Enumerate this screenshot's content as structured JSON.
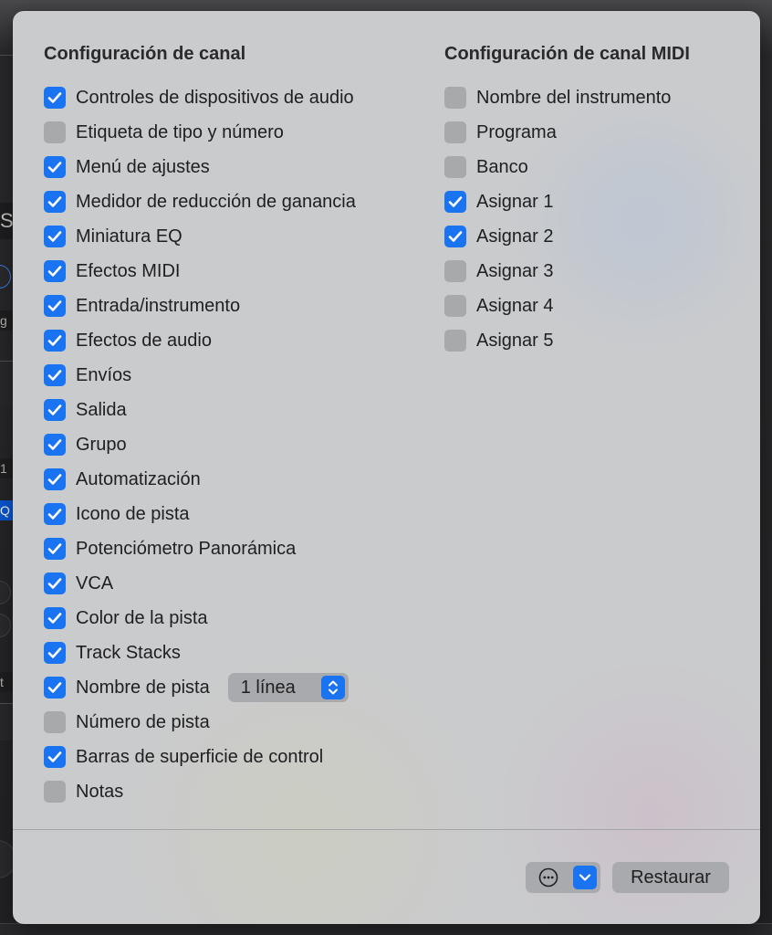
{
  "left_column": {
    "title": "Configuración de canal",
    "options": [
      {
        "label": "Controles de dispositivos de audio",
        "checked": true
      },
      {
        "label": "Etiqueta de tipo y número",
        "checked": false
      },
      {
        "label": "Menú de ajustes",
        "checked": true
      },
      {
        "label": "Medidor de reducción de ganancia",
        "checked": true
      },
      {
        "label": "Miniatura EQ",
        "checked": true
      },
      {
        "label": "Efectos MIDI",
        "checked": true
      },
      {
        "label": "Entrada/instrumento",
        "checked": true
      },
      {
        "label": "Efectos de audio",
        "checked": true
      },
      {
        "label": "Envíos",
        "checked": true
      },
      {
        "label": "Salida",
        "checked": true
      },
      {
        "label": "Grupo",
        "checked": true
      },
      {
        "label": "Automatización",
        "checked": true
      },
      {
        "label": "Icono de pista",
        "checked": true
      },
      {
        "label": "Potenciómetro Panorámica",
        "checked": true
      },
      {
        "label": "VCA",
        "checked": true
      },
      {
        "label": "Color de la pista",
        "checked": true
      },
      {
        "label": "Track Stacks",
        "checked": true
      },
      {
        "label": "Nombre de pista",
        "checked": true
      },
      {
        "label": "Número de pista",
        "checked": false
      },
      {
        "label": "Barras de superficie de control",
        "checked": true
      },
      {
        "label": "Notas",
        "checked": false
      }
    ],
    "track_name_lines": {
      "selected": "1 línea",
      "icon": "up-down-chevron-icon"
    }
  },
  "right_column": {
    "title": "Configuración de canal MIDI",
    "options": [
      {
        "label": "Nombre del instrumento",
        "checked": false
      },
      {
        "label": "Programa",
        "checked": false
      },
      {
        "label": "Banco",
        "checked": false
      },
      {
        "label": "Asignar 1",
        "checked": true
      },
      {
        "label": "Asignar 2",
        "checked": true
      },
      {
        "label": "Asignar 3",
        "checked": false
      },
      {
        "label": "Asignar 4",
        "checked": false
      },
      {
        "label": "Asignar 5",
        "checked": false
      }
    ]
  },
  "footer": {
    "action_menu_icon": "ellipsis-circle-icon",
    "action_menu_chevron": "chevron-down-icon",
    "restore_label": "Restaurar"
  },
  "background_fragments": {
    "left_edge_texts": [
      "So",
      "g",
      "1",
      "Q",
      "t"
    ]
  },
  "colors": {
    "accent": "#1a73f0",
    "panel": "#cacbcd",
    "unchecked": "#a8a9ab",
    "text": "#1f1f21"
  }
}
